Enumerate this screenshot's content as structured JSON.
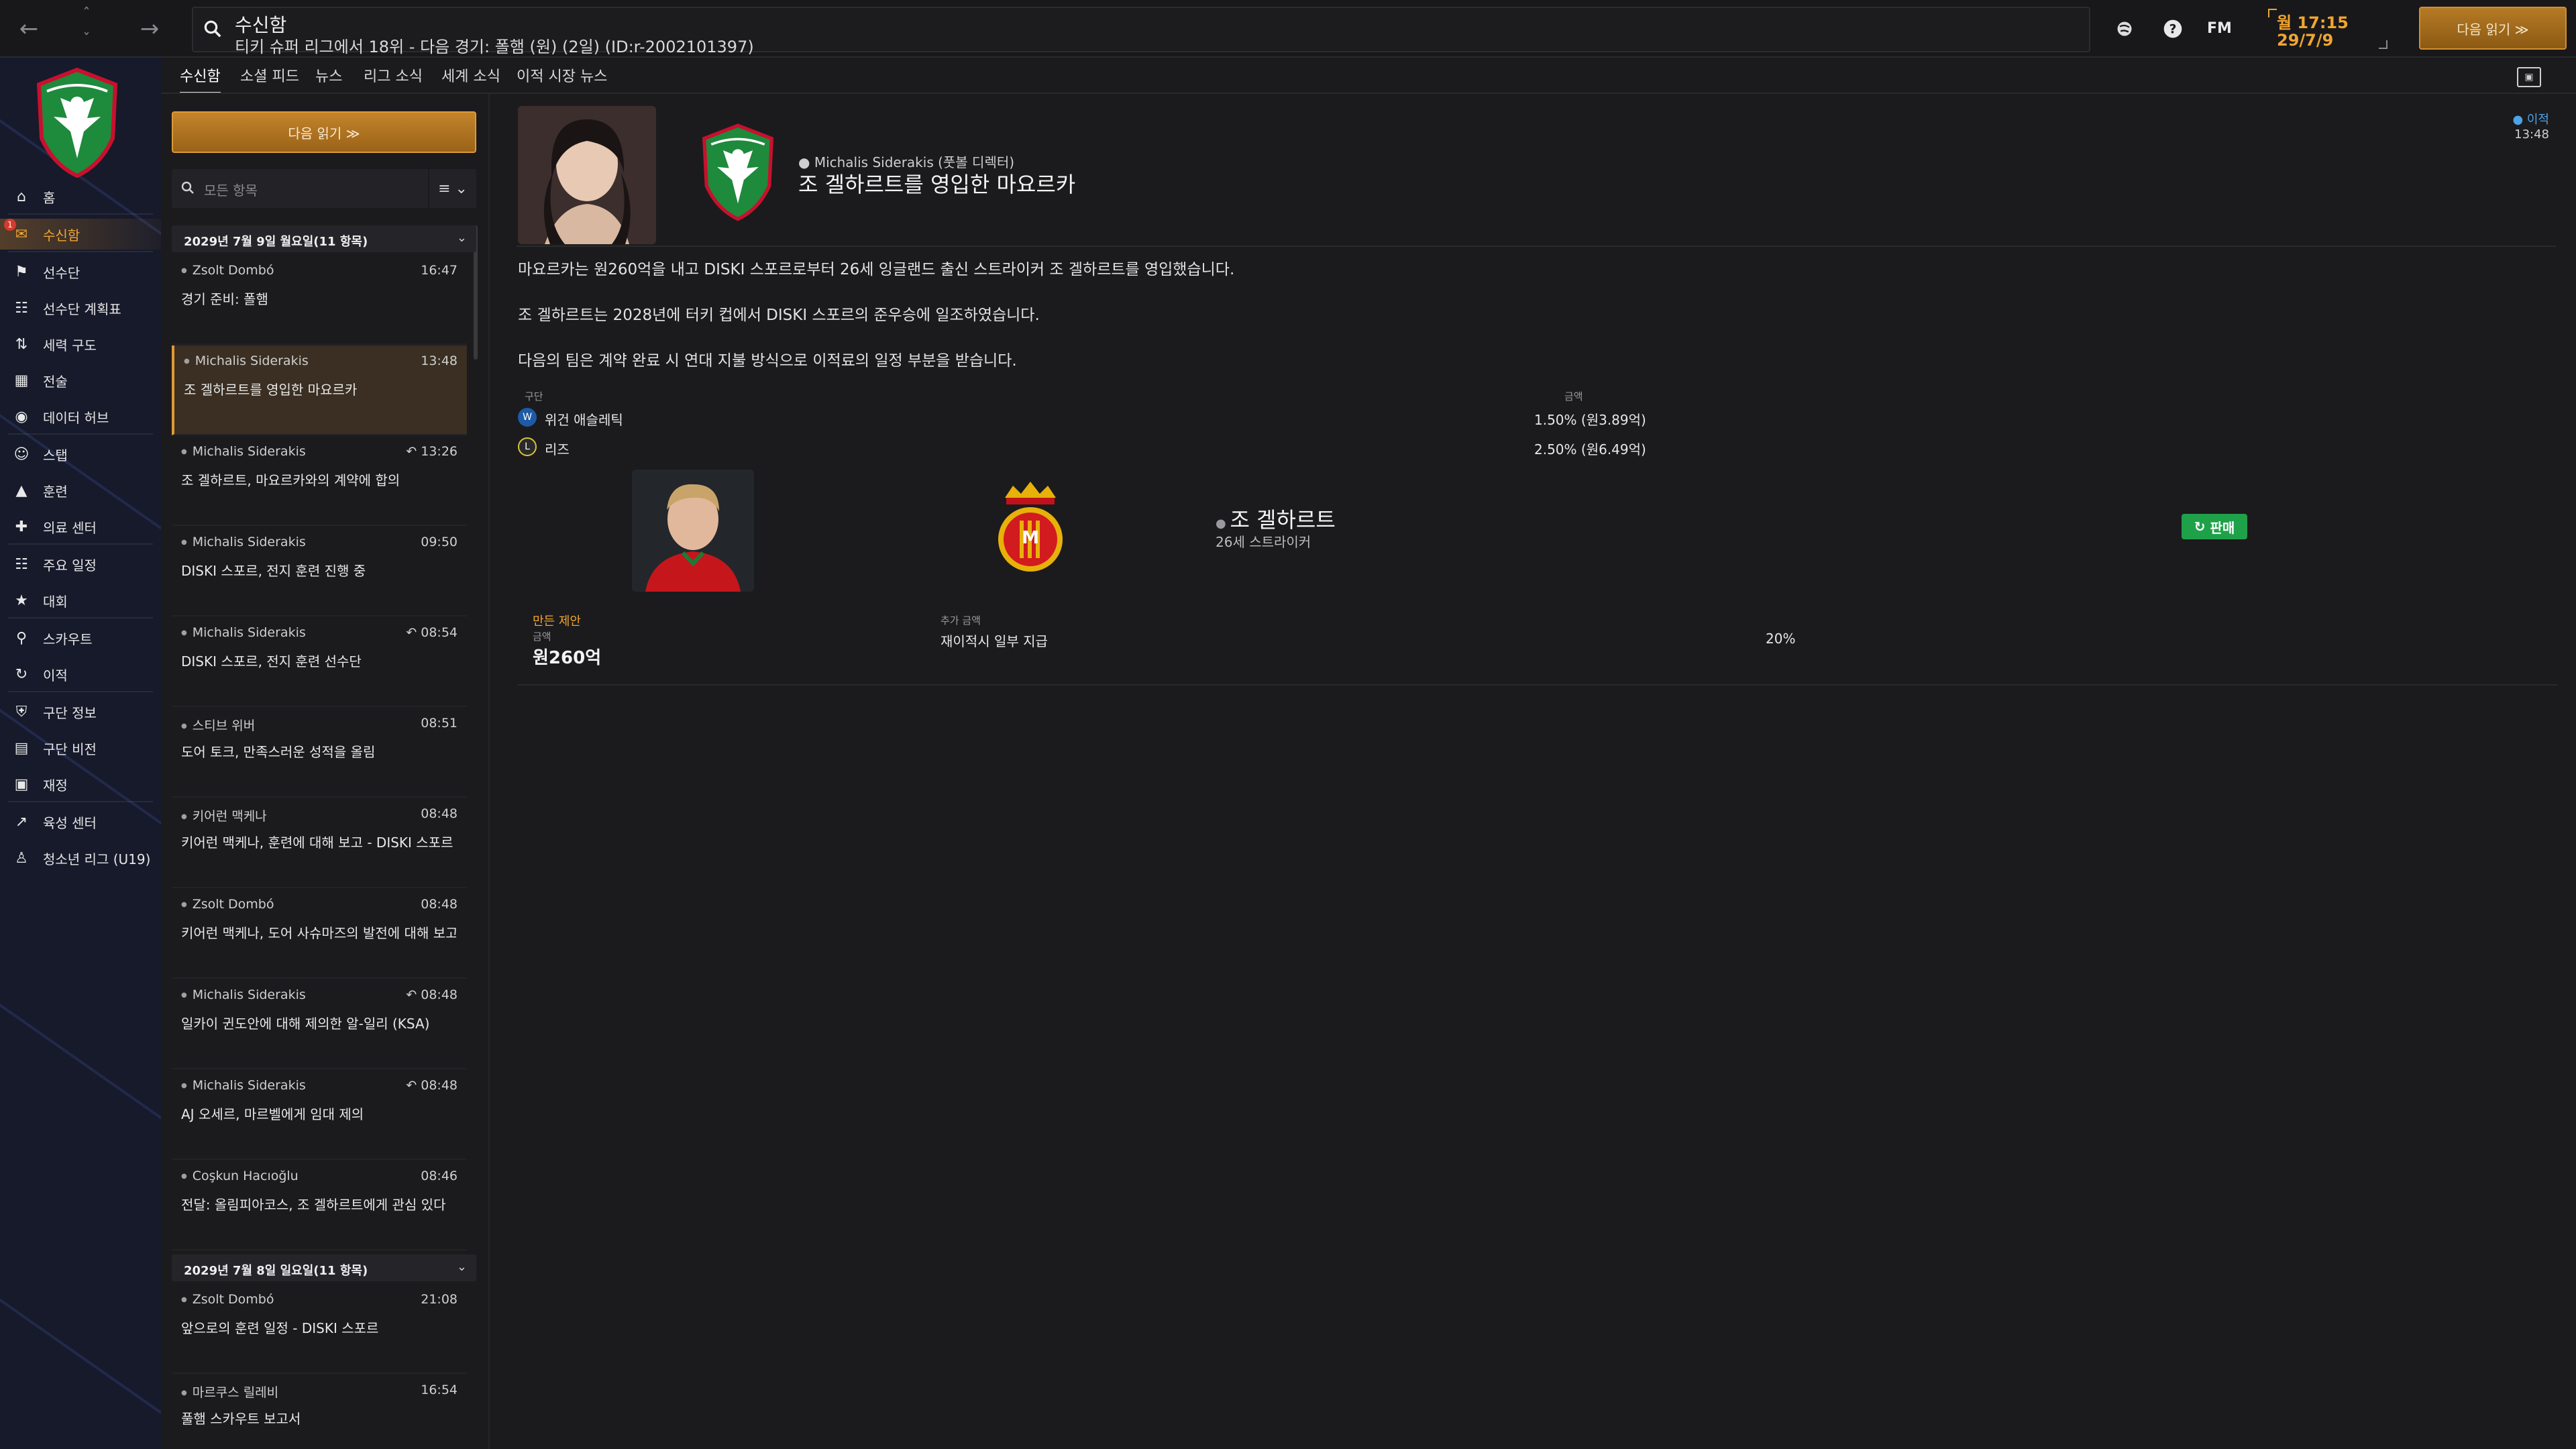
{
  "topbar": {
    "title": "수신함",
    "subtitle": "티키 슈퍼 리그에서 18위 - 다음 경기: 폴햄 (원) (2일) (ID:r-2002101397)",
    "fm_label": "FM",
    "day_time": "월 17:15",
    "date": "29/7/9",
    "next_button": "다음 읽기 ≫"
  },
  "sidebar": {
    "items": [
      {
        "label": "홈",
        "icon": "home-icon"
      },
      {
        "label": "수신함",
        "icon": "inbox-icon",
        "badge": "1"
      },
      {
        "label": "선수단",
        "icon": "shirt-icon"
      },
      {
        "label": "선수단 계획표",
        "icon": "clipboard-icon"
      },
      {
        "label": "세력 구도",
        "icon": "dynamics-icon"
      },
      {
        "label": "전술",
        "icon": "tactics-icon"
      },
      {
        "label": "데이터 허브",
        "icon": "data-hub-icon"
      },
      {
        "label": "스탭",
        "icon": "staff-icon"
      },
      {
        "label": "훈련",
        "icon": "training-icon"
      },
      {
        "label": "의료 센터",
        "icon": "medical-icon"
      },
      {
        "label": "주요 일정",
        "icon": "calendar-icon"
      },
      {
        "label": "대회",
        "icon": "trophy-icon"
      },
      {
        "label": "스카우트",
        "icon": "scout-icon"
      },
      {
        "label": "이적",
        "icon": "transfer-icon"
      },
      {
        "label": "구단 정보",
        "icon": "shield-icon"
      },
      {
        "label": "구단 비전",
        "icon": "vision-icon"
      },
      {
        "label": "재정",
        "icon": "finance-icon"
      },
      {
        "label": "육성 센터",
        "icon": "development-icon"
      },
      {
        "label": "청소년 리그 (U19)",
        "icon": "youth-icon"
      }
    ]
  },
  "tabs": [
    "수신함",
    "소셜 피드",
    "뉴스",
    "리그 소식",
    "세계 소식",
    "이적 시장 뉴스"
  ],
  "list": {
    "read_next": "다음 읽기 ≫",
    "filter_placeholder": "모든 항목",
    "filter_btn": "≡ ⌄",
    "groups": [
      {
        "header": "2029년 7월 9일 월요일(11 항목)",
        "messages": [
          {
            "sender": "Zsolt Dombó",
            "time": "16:47",
            "subject": "경기 준비: 폴햄",
            "reply": false
          },
          {
            "sender": "Michalis Siderakis",
            "time": "13:48",
            "subject": "조 겔하르트를 영입한 마요르카",
            "reply": false,
            "selected": true
          },
          {
            "sender": "Michalis Siderakis",
            "time": "13:26",
            "subject": "조 겔하르트, 마요르카와의 계약에 합의",
            "reply": true
          },
          {
            "sender": "Michalis Siderakis",
            "time": "09:50",
            "subject": "DISKI 스포르, 전지 훈련 진행 중",
            "reply": false
          },
          {
            "sender": "Michalis Siderakis",
            "time": "08:54",
            "subject": "DISKI 스포르, 전지 훈련 선수단",
            "reply": true
          },
          {
            "sender": "스티브 위버",
            "time": "08:51",
            "subject": "도어 토크, 만족스러운 성적을 올림",
            "reply": false
          },
          {
            "sender": "키어런 맥케나",
            "time": "08:48",
            "subject": "키어런 맥케나, 훈련에 대해 보고 - DISKI 스포르",
            "reply": false
          },
          {
            "sender": "Zsolt Dombó",
            "time": "08:48",
            "subject": "키어런 맥케나, 도어 사슈마즈의 발전에 대해 보고",
            "reply": false
          },
          {
            "sender": "Michalis Siderakis",
            "time": "08:48",
            "subject": "일카이 귄도안에 대해 제의한 알-일리 (KSA)",
            "reply": true
          },
          {
            "sender": "Michalis Siderakis",
            "time": "08:48",
            "subject": "AJ 오세르, 마르벨에게 임대 제의",
            "reply": true
          },
          {
            "sender": "Coşkun Hacıoğlu",
            "time": "08:46",
            "subject": "전달: 올림피아코스, 조 겔하르트에게 관심 있다",
            "reply": false
          }
        ]
      },
      {
        "header": "2029년 7월 8일 일요일(11 항목)",
        "messages": [
          {
            "sender": "Zsolt Dombó",
            "time": "21:08",
            "subject": "앞으로의 훈련 일정 - DISKI 스포르",
            "reply": false
          },
          {
            "sender": "마르쿠스 릴레비",
            "time": "16:54",
            "subject": "풀햄 스카우트 보고서",
            "reply": false
          }
        ]
      }
    ]
  },
  "detail": {
    "from": "Michalis Siderakis (풋볼 디렉터)",
    "headline": "조 겔하르트를 영입한 마요르카",
    "tag": "이적",
    "time": "13:48",
    "paragraphs": [
      "마요르카는 원260억을 내고 DISKI 스포르로부터 26세 잉글랜드 출신 스트라이커 조 겔하르트를 영입했습니다.",
      "조 겔하르트는 2028년에 터키 컵에서 DISKI 스포르의 준우승에 일조하였습니다.",
      "다음의 팀은 계약 완료 시 연대 지불 방식으로 이적료의 일정 부분을 받습니다."
    ],
    "table": {
      "col_club": "구단",
      "col_amount": "금액",
      "rows": [
        {
          "club": "위건 애슬레틱",
          "amount": "1.50% (원3.89억)",
          "color": "#1e5aa8",
          "icon": "W"
        },
        {
          "club": "리즈",
          "amount": "2.50% (원6.49억)",
          "color": "#2a2a2a",
          "icon": "L"
        }
      ]
    },
    "transfer": {
      "player_name": "조 겔하르트",
      "player_role": "26세 스트라이커",
      "status": "판매",
      "fee_label": "만든 제안",
      "fee_sublabel": "금액",
      "fee_value": "원260억",
      "addon_label": "추가 금액",
      "addon_desc": "재이적시 일부 지급",
      "addon_pct": "20%"
    }
  }
}
